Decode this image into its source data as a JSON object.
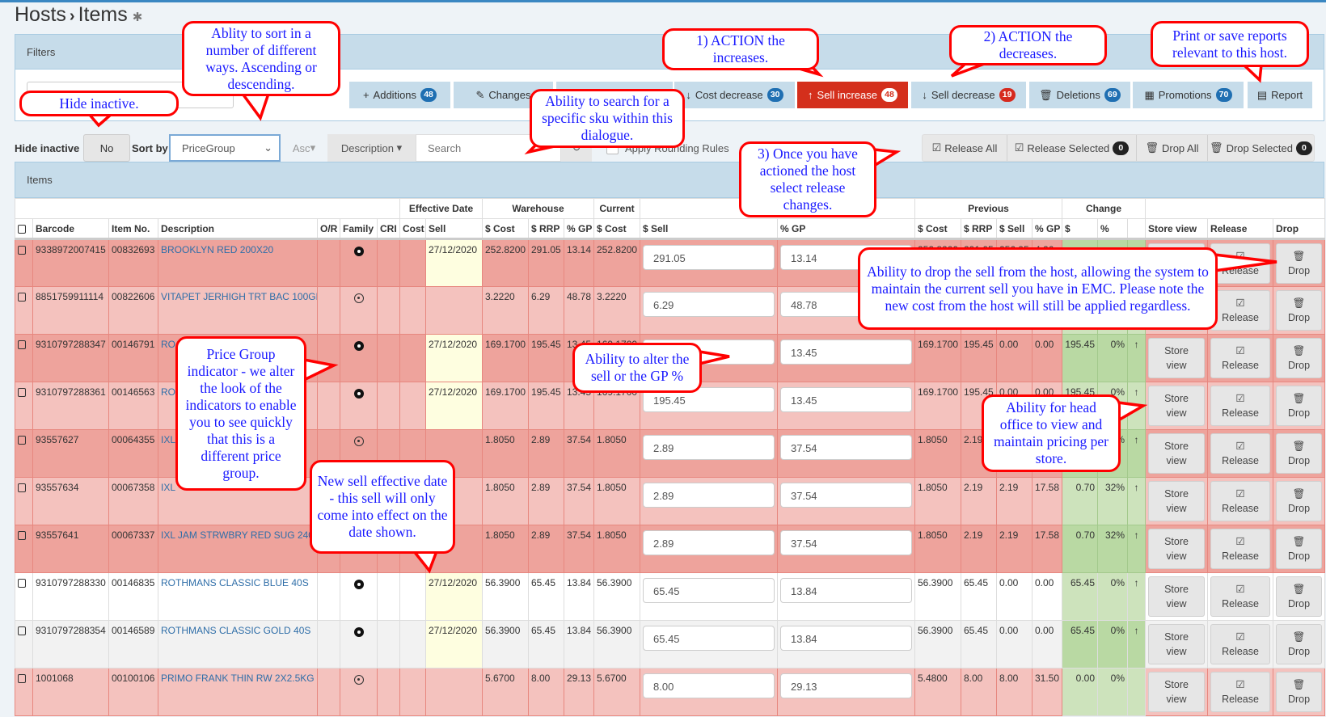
{
  "breadcrumb": {
    "parent": "Hosts",
    "separator": "›",
    "current": "Items",
    "pin_icon": "pin-icon"
  },
  "filters": {
    "title": "Filters",
    "buttons": [
      {
        "label": "Additions",
        "badge": "48",
        "icon": "plus-icon",
        "glyph": "+"
      },
      {
        "label": "Changes",
        "badge": "",
        "icon": "edit-icon",
        "glyph": "✎"
      },
      {
        "label": "",
        "badge": "",
        "icon": "",
        "glyph": ""
      },
      {
        "label": "Cost decrease",
        "badge": "30",
        "icon": "arrow-down-icon",
        "glyph": "↓"
      },
      {
        "label": "Sell increase",
        "badge": "48",
        "icon": "arrow-up-icon",
        "glyph": "↑",
        "active": true
      },
      {
        "label": "Sell decrease",
        "badge": "19",
        "icon": "arrow-down-icon",
        "glyph": "↓"
      },
      {
        "label": "Deletions",
        "badge": "69",
        "icon": "trash-icon",
        "glyph": "🗑"
      },
      {
        "label": "Promotions",
        "badge": "70",
        "icon": "calendar-icon",
        "glyph": "▦"
      },
      {
        "label": "Report",
        "badge": "",
        "icon": "file-icon",
        "glyph": "▤"
      }
    ]
  },
  "controls": {
    "hide_inactive_label": "Hide inactive",
    "hide_inactive_value": "No",
    "sort_by_label": "Sort by",
    "sort_by_value": "PriceGroup",
    "order": "Asc",
    "search_field": "Description",
    "search_placeholder": "Search",
    "apply_rounding": "Apply Rounding Rules",
    "release_all": "Release All",
    "release_selected": "Release Selected",
    "release_selected_count": "0",
    "drop_all": "Drop All",
    "drop_selected": "Drop Selected",
    "drop_selected_count": "0"
  },
  "items": {
    "title": "Items",
    "group_headers": {
      "effective_date": "Effective Date",
      "warehouse": "Warehouse",
      "current": "Current",
      "previous": "Previous",
      "change": "Change"
    },
    "columns": [
      "Barcode",
      "Item No.",
      "Description",
      "O/R",
      "Family",
      "CRI",
      "Cost",
      "Sell",
      "$ Cost",
      "$ RRP",
      "% GP",
      "$ Cost",
      "$ Sell",
      "% GP",
      "$ Cost",
      "$ RRP",
      "$ Sell",
      "% GP",
      "$",
      "%",
      "",
      "Store view",
      "Release",
      "Drop"
    ],
    "action_labels": {
      "store_view_1": "Store",
      "store_view_2": "view",
      "release": "Release",
      "drop": "Drop"
    },
    "rows": [
      {
        "style": "dk",
        "barcode": "9338972007415",
        "item": "00832693",
        "desc": "BROOKLYN RED 200X20",
        "family": "dark",
        "date": "27/12/2020",
        "wcost": "252.8200",
        "wrrp": "291.05",
        "wgp": "13.14",
        "ccost": "252.8200",
        "sell": "291.05",
        "gp": "13.14",
        "pcost": "252.8200",
        "prrp": "291.05",
        "psell": "256.95",
        "pgp": "4.26",
        "cd": "",
        "cp": "",
        "arrow": "↑"
      },
      {
        "style": "lt",
        "barcode": "8851759911114",
        "item": "00822606",
        "desc": "VITAPET JERHIGH TRT BAC 100GM",
        "family": "light",
        "date": "",
        "wcost": "3.2220",
        "wrrp": "6.29",
        "wgp": "48.78",
        "ccost": "3.2220",
        "sell": "6.29",
        "gp": "48.78",
        "pcost": "",
        "prrp": "",
        "psell": "",
        "pgp": "",
        "cd": "",
        "cp": "",
        "arrow": ""
      },
      {
        "style": "dk",
        "barcode": "9310797288347",
        "item": "00146791",
        "desc": "RO",
        "family": "dark",
        "date": "27/12/2020",
        "wcost": "169.1700",
        "wrrp": "195.45",
        "wgp": "13.45",
        "ccost": "169.1700",
        "sell": "195.45",
        "gp": "13.45",
        "pcost": "169.1700",
        "prrp": "195.45",
        "psell": "0.00",
        "pgp": "0.00",
        "cd": "195.45",
        "cp": "0%",
        "arrow": "↑"
      },
      {
        "style": "lt",
        "barcode": "9310797288361",
        "item": "00146563",
        "desc": "RO",
        "family": "dark",
        "date": "27/12/2020",
        "wcost": "169.1700",
        "wrrp": "195.45",
        "wgp": "13.45",
        "ccost": "169.1700",
        "sell": "195.45",
        "gp": "13.45",
        "pcost": "169.1700",
        "prrp": "195.45",
        "psell": "0.00",
        "pgp": "0.00",
        "cd": "195.45",
        "cp": "0%",
        "arrow": "↑"
      },
      {
        "style": "dk",
        "barcode": "93557627",
        "item": "00064355",
        "desc": "IXL",
        "family": "light",
        "date": "",
        "wcost": "1.8050",
        "wrrp": "2.89",
        "wgp": "37.54",
        "ccost": "1.8050",
        "sell": "2.89",
        "gp": "37.54",
        "pcost": "1.8050",
        "prrp": "2.19",
        "psell": "2.19",
        "pgp": "17.58",
        "cd": "0.70",
        "cp": "32%",
        "arrow": "↑"
      },
      {
        "style": "lt",
        "barcode": "93557634",
        "item": "00067358",
        "desc": "IXL",
        "family": "light",
        "date": "",
        "wcost": "1.8050",
        "wrrp": "2.89",
        "wgp": "37.54",
        "ccost": "1.8050",
        "sell": "2.89",
        "gp": "37.54",
        "pcost": "1.8050",
        "prrp": "2.19",
        "psell": "2.19",
        "pgp": "17.58",
        "cd": "0.70",
        "cp": "32%",
        "arrow": "↑"
      },
      {
        "style": "dk",
        "barcode": "93557641",
        "item": "00067337",
        "desc": "IXL JAM STRWBRY RED SUG 240GM",
        "family": "light",
        "date": "",
        "wcost": "1.8050",
        "wrrp": "2.89",
        "wgp": "37.54",
        "ccost": "1.8050",
        "sell": "2.89",
        "gp": "37.54",
        "pcost": "1.8050",
        "prrp": "2.19",
        "psell": "2.19",
        "pgp": "17.58",
        "cd": "0.70",
        "cp": "32%",
        "arrow": "↑"
      },
      {
        "style": "wh",
        "barcode": "9310797288330",
        "item": "00146835",
        "desc": "ROTHMANS CLASSIC BLUE 40S",
        "family": "dark",
        "date": "27/12/2020",
        "wcost": "56.3900",
        "wrrp": "65.45",
        "wgp": "13.84",
        "ccost": "56.3900",
        "sell": "65.45",
        "gp": "13.84",
        "pcost": "56.3900",
        "prrp": "65.45",
        "psell": "0.00",
        "pgp": "0.00",
        "cd": "65.45",
        "cp": "0%",
        "arrow": "↑"
      },
      {
        "style": "gr",
        "barcode": "9310797288354",
        "item": "00146589",
        "desc": "ROTHMANS CLASSIC GOLD 40S",
        "family": "dark",
        "date": "27/12/2020",
        "wcost": "56.3900",
        "wrrp": "65.45",
        "wgp": "13.84",
        "ccost": "56.3900",
        "sell": "65.45",
        "gp": "13.84",
        "pcost": "56.3900",
        "prrp": "65.45",
        "psell": "0.00",
        "pgp": "0.00",
        "cd": "65.45",
        "cp": "0%",
        "arrow": "↑"
      },
      {
        "style": "lt",
        "barcode": "1001068",
        "item": "00100106",
        "desc": "PRIMO FRANK THIN RW 2X2.5KG",
        "family": "light",
        "date": "",
        "wcost": "5.6700",
        "wrrp": "8.00",
        "wgp": "29.13",
        "ccost": "5.6700",
        "sell": "8.00",
        "gp": "29.13",
        "pcost": "5.4800",
        "prrp": "8.00",
        "psell": "8.00",
        "pgp": "31.50",
        "cd": "0.00",
        "cp": "0%",
        "arrow": "",
        "nochange": true
      }
    ]
  },
  "callouts": {
    "sort": "Ablity to sort in a number of different ways. Ascending or descending.",
    "hide": "Hide inactive.",
    "search": "Ability to search for a specific sku within this dialogue.",
    "action1": "1) ACTION the increases.",
    "action2": "2) ACTION the decreases.",
    "print": "Print or save reports relevant to this host.",
    "release": "3) Once you have actioned the host select release changes.",
    "drop": "Ability to drop the sell from the host, allowing the system to maintain the current sell you have in EMC.  Please note the new cost from the host will still be applied regardless.",
    "pricegroup": "Price Group indicator - we alter the look of the indicators to enable you to see quickly that this is a different price group.",
    "alter": "Ability to alter the sell or the GP %",
    "headoffice": "Ability for head office to view and maintain pricing per store.",
    "effective": "New sell effective date - this sell will only come into effect on the date shown."
  },
  "colors": {
    "accent": "#3a87c2",
    "active_button": "#d42f1c",
    "callout_border": "#ff0000",
    "callout_text": "#1a1aff",
    "row_dark": "#eea39c",
    "row_light": "#f4c2be",
    "change_green": "#b9d9a3"
  }
}
